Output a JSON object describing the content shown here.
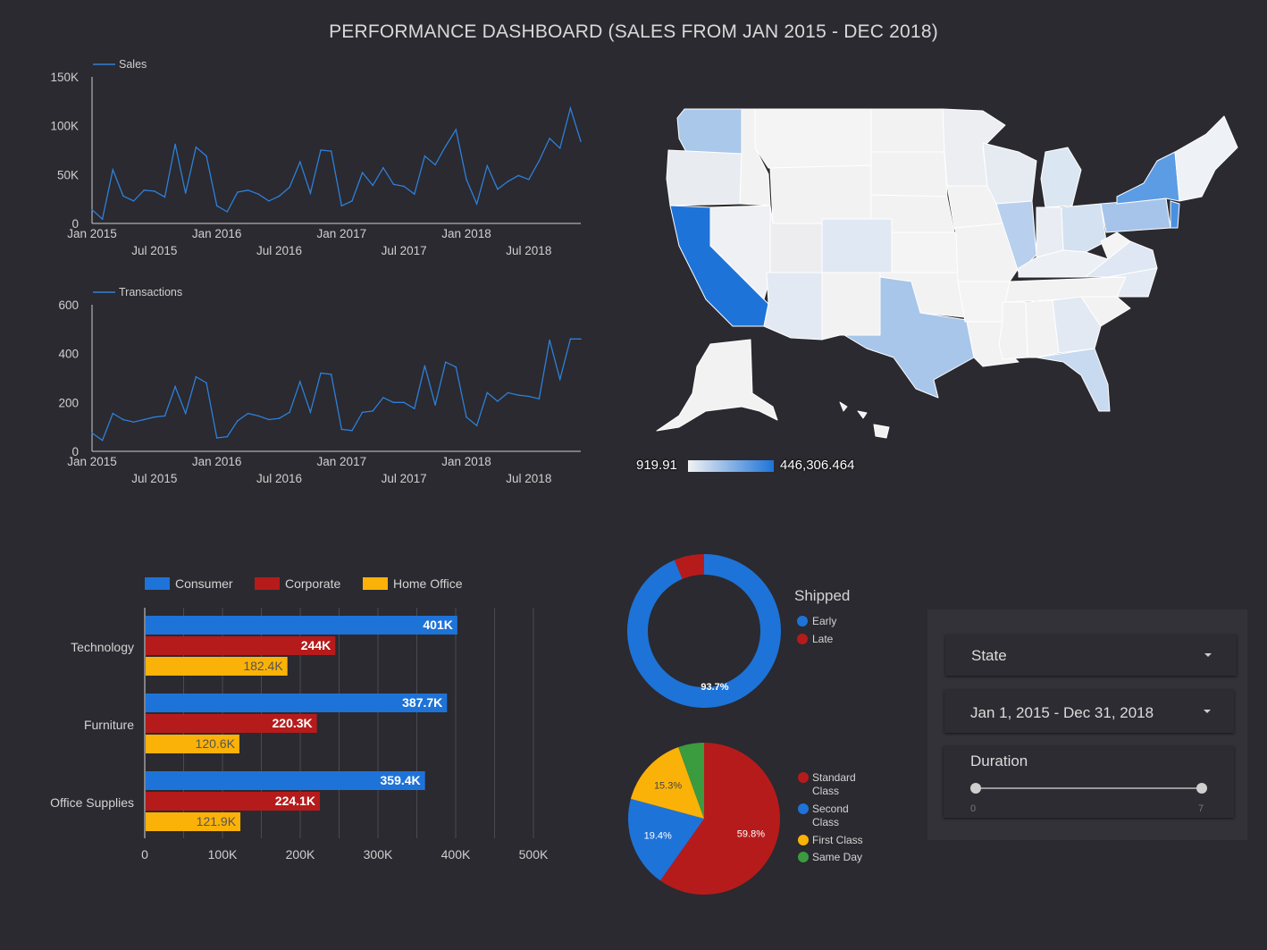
{
  "dashboard": {
    "title": "PERFORMANCE DASHBOARD (SALES FROM JAN 2015 - DEC 2018)"
  },
  "chart_data": [
    {
      "type": "line",
      "legend": "Sales",
      "ylim": [
        0,
        150000
      ],
      "yticks": [
        "0",
        "50K",
        "100K",
        "150K"
      ],
      "xticks_top": [
        "Jan 2015",
        "Jan 2016",
        "Jan 2017",
        "Jan 2018"
      ],
      "xticks_bottom": [
        "Jul 2015",
        "Jul 2016",
        "Jul 2017",
        "Jul 2018"
      ],
      "color": "#2f7fd8",
      "values": [
        14000,
        4500,
        55000,
        28000,
        23000,
        34000,
        33000,
        27000,
        81000,
        31000,
        78000,
        69000,
        18000,
        12000,
        32000,
        34000,
        30000,
        23000,
        28000,
        37000,
        63000,
        31000,
        75000,
        74000,
        18000,
        23000,
        52000,
        39000,
        57000,
        40000,
        38000,
        30000,
        69000,
        60000,
        79000,
        96000,
        45000,
        20000,
        59000,
        35000,
        43000,
        49000,
        45000,
        64000,
        87000,
        77000,
        118000,
        84000
      ]
    },
    {
      "type": "line",
      "legend": "Transactions",
      "ylim": [
        0,
        600
      ],
      "yticks": [
        "0",
        "200",
        "400",
        "600"
      ],
      "xticks_top": [
        "Jan 2015",
        "Jan 2016",
        "Jan 2017",
        "Jan 2018"
      ],
      "xticks_bottom": [
        "Jul 2015",
        "Jul 2016",
        "Jul 2017",
        "Jul 2018"
      ],
      "color": "#2f7fd8",
      "values": [
        75,
        45,
        155,
        130,
        120,
        130,
        140,
        145,
        265,
        155,
        305,
        280,
        55,
        60,
        125,
        155,
        145,
        130,
        135,
        160,
        285,
        160,
        320,
        315,
        90,
        85,
        160,
        165,
        220,
        200,
        200,
        175,
        350,
        190,
        365,
        345,
        140,
        105,
        240,
        205,
        240,
        230,
        225,
        215,
        455,
        295,
        460,
        460
      ]
    },
    {
      "type": "bar",
      "orientation": "horizontal",
      "categories": [
        "Technology",
        "Furniture",
        "Office Supplies"
      ],
      "series": [
        {
          "name": "Consumer",
          "color": "#1e73d8",
          "values": [
            401000,
            387700,
            359400
          ],
          "labels": [
            "401K",
            "387.7K",
            "359.4K"
          ]
        },
        {
          "name": "Corporate",
          "color": "#b61b1b",
          "values": [
            244000,
            220300,
            224100
          ],
          "labels": [
            "244K",
            "220.3K",
            "224.1K"
          ]
        },
        {
          "name": "Home Office",
          "color": "#fbb208",
          "values": [
            182400,
            120600,
            121900
          ],
          "labels": [
            "182.4K",
            "120.6K",
            "121.9K"
          ]
        }
      ],
      "xlim": [
        0,
        500000
      ],
      "xticks": [
        "0",
        "100K",
        "200K",
        "300K",
        "400K",
        "500K"
      ]
    },
    {
      "type": "pie",
      "donut": true,
      "title": "Shipped",
      "slices": [
        {
          "name": "Early",
          "value": 93.7,
          "color": "#1e73d8",
          "label": "93.7%"
        },
        {
          "name": "Late",
          "value": 6.3,
          "color": "#b61b1b",
          "label": ""
        }
      ]
    },
    {
      "type": "pie",
      "donut": false,
      "slices": [
        {
          "name": "Standard Class",
          "value": 59.8,
          "color": "#b61b1b",
          "label": "59.8%"
        },
        {
          "name": "Second Class",
          "value": 19.4,
          "color": "#1e73d8",
          "label": "19.4%"
        },
        {
          "name": "First Class",
          "value": 15.3,
          "color": "#fbb208",
          "label": "15.3%"
        },
        {
          "name": "Same Day",
          "value": 5.5,
          "color": "#3a9b3f",
          "label": ""
        }
      ],
      "legend_labels": [
        [
          "Standard",
          "Class"
        ],
        [
          "Second",
          "Class"
        ],
        [
          "First Class"
        ],
        [
          "Same Day"
        ]
      ]
    }
  ],
  "map": {
    "scale_min": "919.91",
    "scale_max": "446,306.464",
    "color_low": "#f2f2f2",
    "color_high": "#1e73d8"
  },
  "controls": {
    "state_label": "State",
    "date_label": "Jan 1, 2015 - Dec 31, 2018",
    "duration_label": "Duration",
    "duration_min": "0",
    "duration_max": "7",
    "duration_range": [
      0,
      7
    ]
  }
}
